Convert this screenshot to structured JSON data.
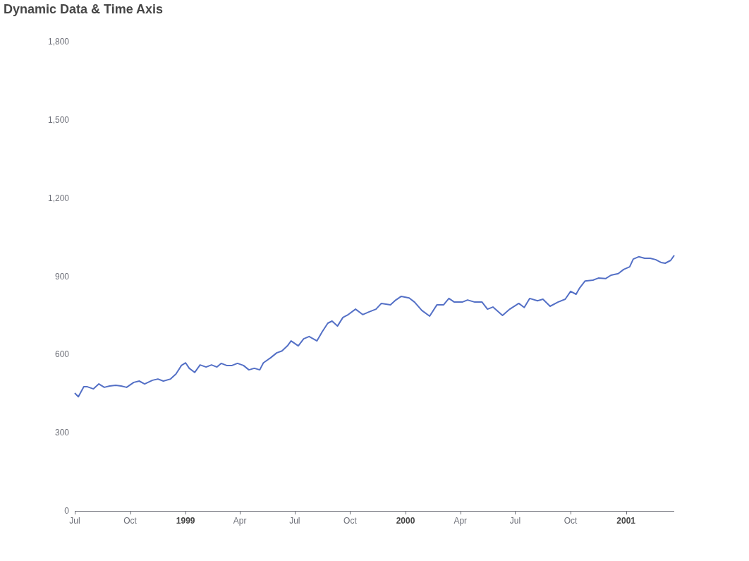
{
  "title": "Dynamic Data & Time Axis",
  "chart": {
    "chart_data": {
      "type": "line",
      "xlim": [
        "1998-07-01",
        "2001-03-22"
      ],
      "ylim": [
        0,
        1800
      ],
      "yticks": [
        {
          "value": 0,
          "label": "0"
        },
        {
          "value": 300,
          "label": "300"
        },
        {
          "value": 600,
          "label": "600"
        },
        {
          "value": 900,
          "label": "900"
        },
        {
          "value": 1200,
          "label": "1,200"
        },
        {
          "value": 1500,
          "label": "1,500"
        },
        {
          "value": 1800,
          "label": "1,800"
        }
      ],
      "xticks": [
        {
          "value": "1998-07-01",
          "label": "Jul"
        },
        {
          "value": "1998-10-01",
          "label": "Oct"
        },
        {
          "value": "1999-01-01",
          "label": "1999"
        },
        {
          "value": "1999-04-01",
          "label": "Apr"
        },
        {
          "value": "1999-07-01",
          "label": "Jul"
        },
        {
          "value": "1999-10-01",
          "label": "Oct"
        },
        {
          "value": "2000-01-01",
          "label": "2000"
        },
        {
          "value": "2000-04-01",
          "label": "Apr"
        },
        {
          "value": "2000-07-01",
          "label": "Jul"
        },
        {
          "value": "2000-10-01",
          "label": "Oct"
        },
        {
          "value": "2001-01-01",
          "label": "2001"
        }
      ],
      "x": [
        "1998-07-01",
        "1998-07-07",
        "1998-07-16",
        "1998-07-22",
        "1998-08-01",
        "1998-08-10",
        "1998-08-19",
        "1998-08-28",
        "1998-09-07",
        "1998-09-16",
        "1998-09-25",
        "1998-10-07",
        "1998-10-16",
        "1998-10-25",
        "1998-11-07",
        "1998-11-16",
        "1998-11-25",
        "1998-12-07",
        "1998-12-16",
        "1998-12-25",
        "1999-01-01",
        "1999-01-07",
        "1999-01-16",
        "1999-01-25",
        "1999-02-04",
        "1999-02-13",
        "1999-02-22",
        "1999-03-01",
        "1999-03-10",
        "1999-03-19",
        "1999-03-28",
        "1999-04-07",
        "1999-04-16",
        "1999-04-25",
        "1999-05-04",
        "1999-05-10",
        "1999-05-22",
        "1999-06-01",
        "1999-06-10",
        "1999-06-19",
        "1999-06-25",
        "1999-07-07",
        "1999-07-16",
        "1999-07-25",
        "1999-08-07",
        "1999-08-16",
        "1999-08-25",
        "1999-09-01",
        "1999-09-10",
        "1999-09-19",
        "1999-09-28",
        "1999-10-10",
        "1999-10-22",
        "1999-11-01",
        "1999-11-13",
        "1999-11-22",
        "1999-12-07",
        "1999-12-16",
        "1999-12-25",
        "2000-01-07",
        "2000-01-16",
        "2000-01-28",
        "2000-02-10",
        "2000-02-22",
        "2000-03-04",
        "2000-03-13",
        "2000-03-22",
        "2000-04-04",
        "2000-04-13",
        "2000-04-25",
        "2000-05-07",
        "2000-05-16",
        "2000-05-25",
        "2000-06-10",
        "2000-06-22",
        "2000-07-07",
        "2000-07-16",
        "2000-07-25",
        "2000-08-07",
        "2000-08-16",
        "2000-08-28",
        "2000-09-10",
        "2000-09-22",
        "2000-10-01",
        "2000-10-10",
        "2000-10-16",
        "2000-10-25",
        "2000-11-07",
        "2000-11-16",
        "2000-11-28",
        "2000-12-07",
        "2000-12-19",
        "2000-12-28",
        "2001-01-07",
        "2001-01-13",
        "2001-01-22",
        "2001-02-01",
        "2001-02-10",
        "2001-02-19",
        "2001-02-28",
        "2001-03-07",
        "2001-03-16",
        "2001-03-22"
      ],
      "series": [
        {
          "color": "#5470c6",
          "values": [
            452,
            438,
            476,
            476,
            468,
            487,
            474,
            479,
            482,
            479,
            474,
            493,
            498,
            487,
            501,
            506,
            498,
            506,
            525,
            558,
            568,
            547,
            531,
            560,
            552,
            560,
            552,
            566,
            558,
            558,
            566,
            558,
            541,
            547,
            541,
            568,
            587,
            606,
            614,
            633,
            652,
            633,
            660,
            669,
            652,
            688,
            720,
            728,
            709,
            742,
            753,
            774,
            753,
            763,
            774,
            796,
            790,
            809,
            823,
            817,
            801,
            769,
            747,
            790,
            790,
            815,
            801,
            801,
            809,
            801,
            801,
            774,
            782,
            750,
            774,
            796,
            780,
            815,
            806,
            812,
            785,
            801,
            812,
            842,
            831,
            855,
            882,
            885,
            893,
            891,
            904,
            910,
            926,
            936,
            966,
            975,
            969,
            969,
            964,
            953,
            950,
            961,
            980
          ]
        }
      ]
    }
  }
}
